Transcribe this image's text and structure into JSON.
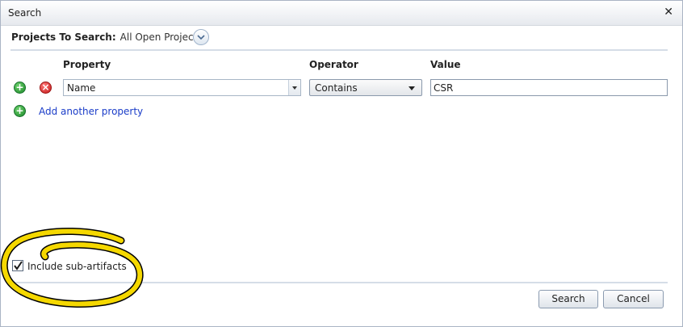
{
  "dialog": {
    "title": "Search",
    "close_glyph": "✕"
  },
  "scope": {
    "label": "Projects To Search:",
    "value": "All Open Projects"
  },
  "columns": {
    "property": "Property",
    "operator": "Operator",
    "value": "Value"
  },
  "criteria_row": {
    "property": "Name",
    "operator": "Contains",
    "value": "CSR"
  },
  "add_property_label": "Add another property",
  "include_sub_artifacts": {
    "label": "Include sub-artifacts",
    "checked": true
  },
  "buttons": {
    "search": "Search",
    "cancel": "Cancel"
  },
  "icons": {
    "add": "plus-circle-icon",
    "remove": "x-circle-icon",
    "expand": "chevron-down-icon",
    "dropdown": "caret-down-icon",
    "check": "checkmark-icon"
  },
  "colors": {
    "add_green": "#1e8a2a",
    "remove_red": "#c41818",
    "link_blue": "#1a3cc8",
    "annotation_yellow": "#f5d800"
  }
}
